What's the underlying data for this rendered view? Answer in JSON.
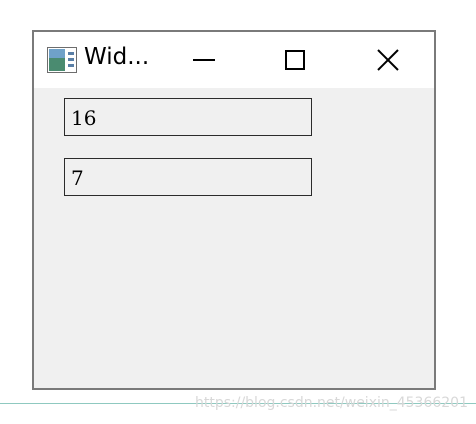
{
  "window": {
    "title": "Wid...",
    "icon": "app-window-icon"
  },
  "controls": {
    "minimize_icon": "minimize-icon",
    "maximize_icon": "maximize-icon",
    "close_icon": "close-icon"
  },
  "fields": [
    {
      "value": "16"
    },
    {
      "value": "7"
    }
  ],
  "watermark": "https://blog.csdn.net/weixin_45366201",
  "colors": {
    "window_background": "#f0f0f0",
    "titlebar_background": "#ffffff",
    "window_border": "#7a7a7a",
    "field_border": "#2b2b2b"
  }
}
